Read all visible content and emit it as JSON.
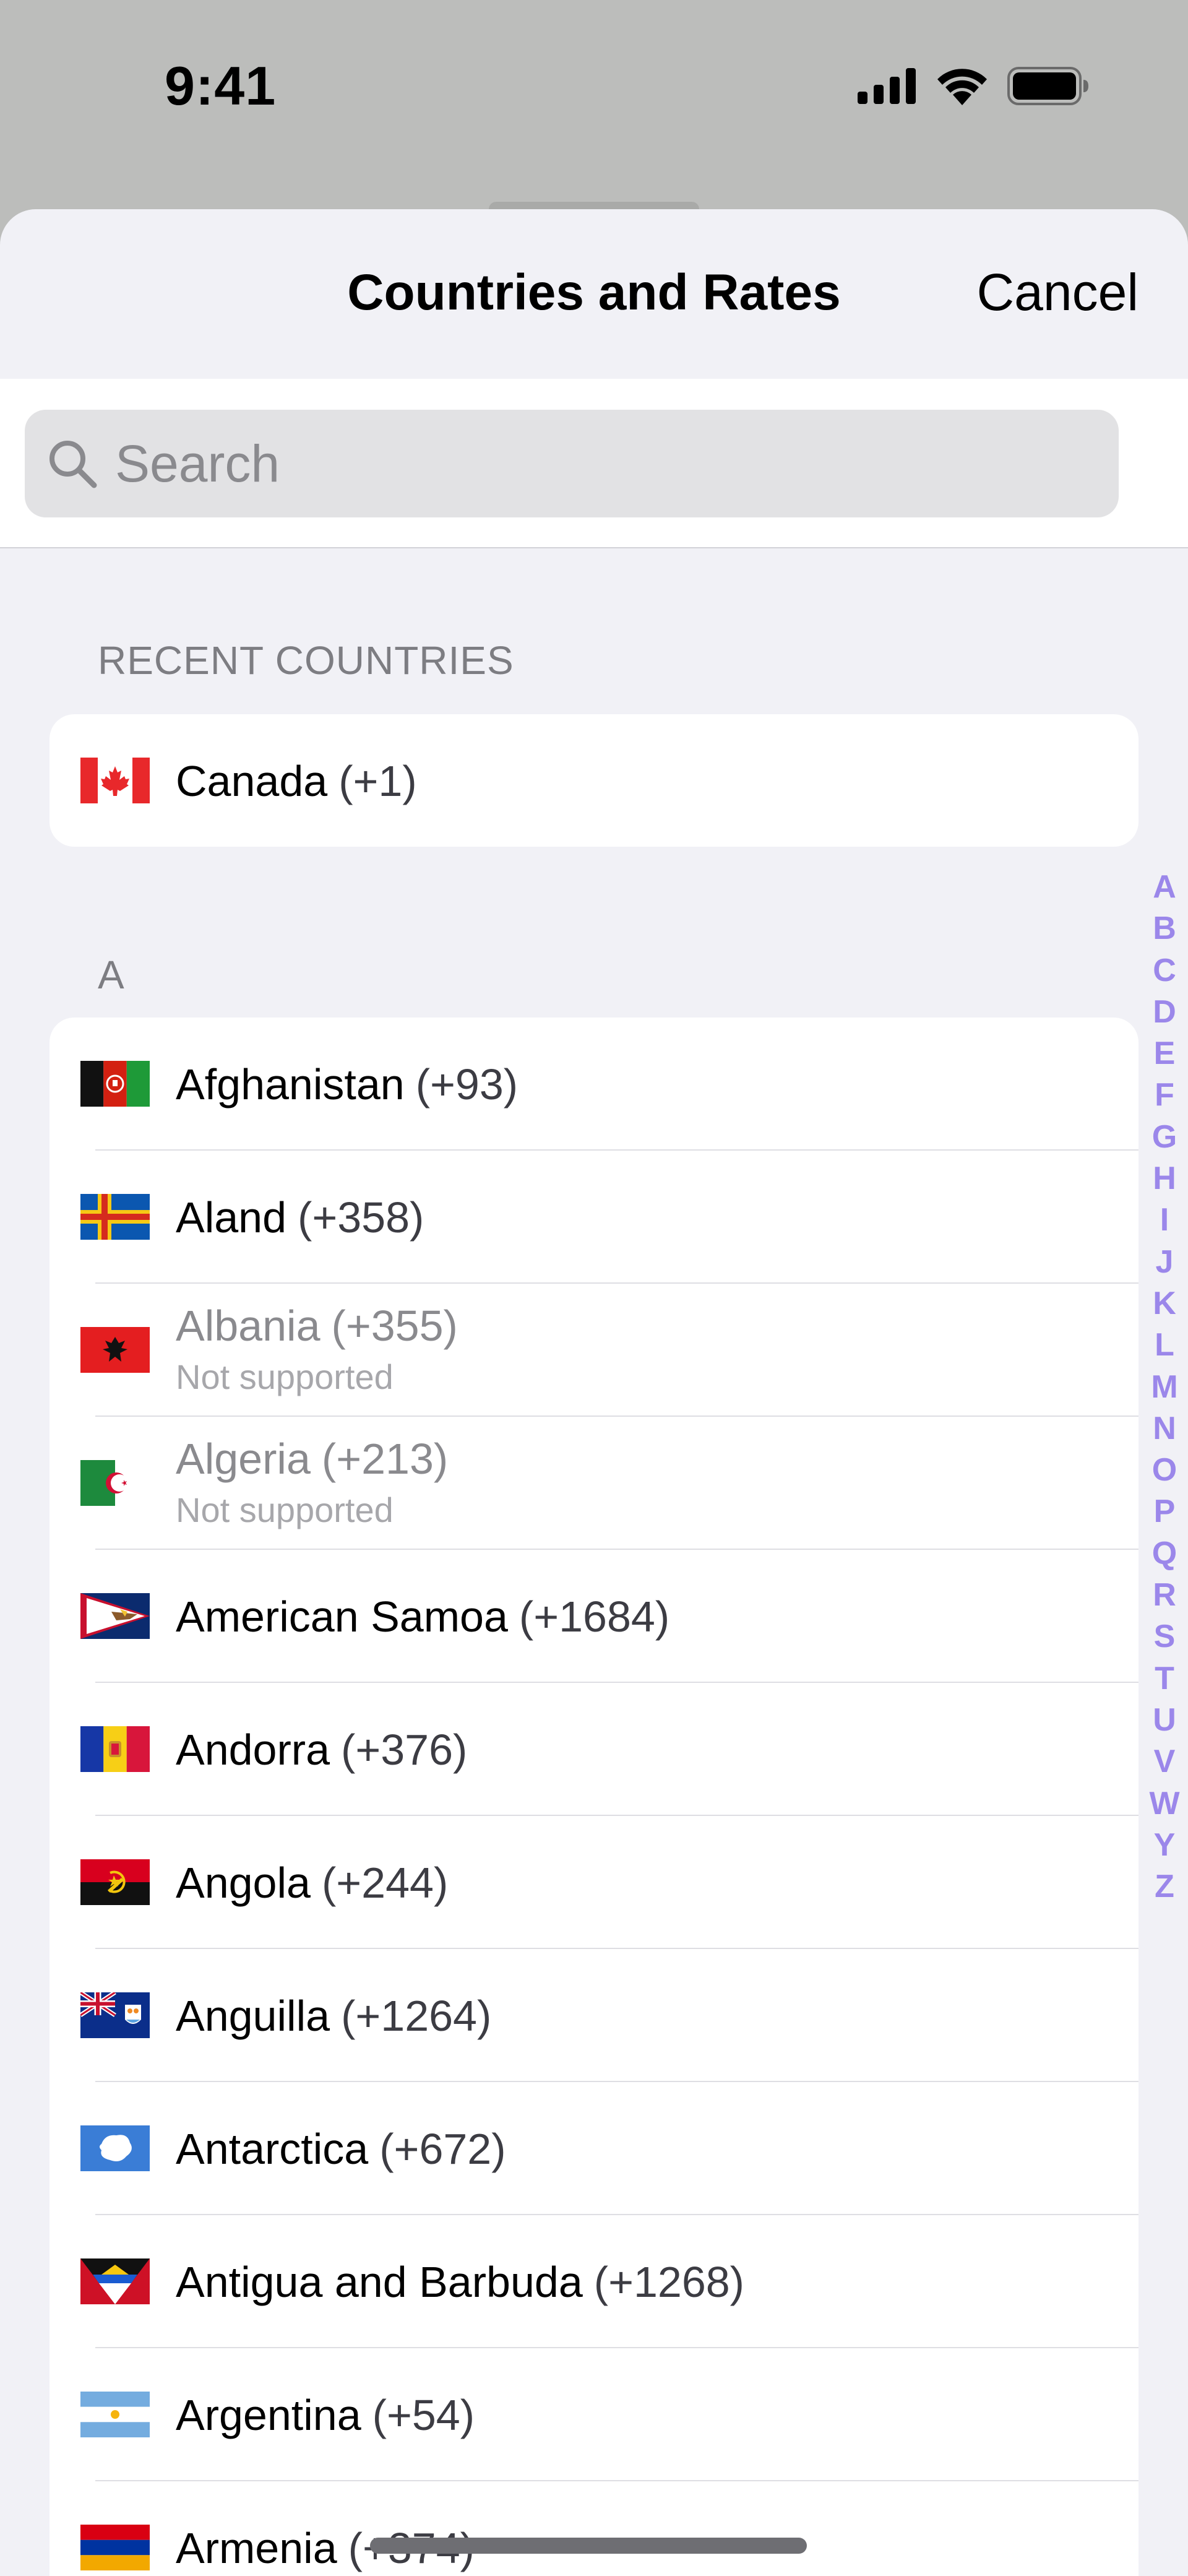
{
  "status_bar": {
    "time": "9:41",
    "icons": [
      "cellular-signal-icon",
      "wifi-icon",
      "battery-icon"
    ]
  },
  "nav": {
    "title": "Countries and Rates",
    "cancel_label": "Cancel"
  },
  "search": {
    "placeholder": "Search",
    "value": ""
  },
  "recent": {
    "header": "RECENT COUNTRIES",
    "items": [
      {
        "name": "Canada",
        "code": "(+1)",
        "flag_icon": "canada-flag-icon"
      }
    ]
  },
  "section_a": {
    "header": "A",
    "items": [
      {
        "name": "Afghanistan",
        "code": "(+93)",
        "flag_icon": "afghanistan-flag-icon"
      },
      {
        "name": "Aland",
        "code": "(+358)",
        "flag_icon": "aland-flag-icon"
      },
      {
        "name": "Albania",
        "code": "(+355)",
        "sub": "Not supported",
        "flag_icon": "albania-flag-icon"
      },
      {
        "name": "Algeria",
        "code": "(+213)",
        "sub": "Not supported",
        "flag_icon": "algeria-flag-icon"
      },
      {
        "name": "American Samoa",
        "code": "(+1684)",
        "flag_icon": "american-samoa-flag-icon"
      },
      {
        "name": "Andorra",
        "code": "(+376)",
        "flag_icon": "andorra-flag-icon"
      },
      {
        "name": "Angola",
        "code": "(+244)",
        "flag_icon": "angola-flag-icon"
      },
      {
        "name": "Anguilla",
        "code": "(+1264)",
        "flag_icon": "anguilla-flag-icon"
      },
      {
        "name": "Antarctica",
        "code": "(+672)",
        "flag_icon": "antarctica-flag-icon"
      },
      {
        "name": "Antigua and Barbuda",
        "code": "(+1268)",
        "flag_icon": "antigua-and-barbuda-flag-icon"
      },
      {
        "name": "Argentina",
        "code": "(+54)",
        "flag_icon": "argentina-flag-icon"
      },
      {
        "name": "Armenia",
        "code": "(+374)",
        "flag_icon": "armenia-flag-icon"
      }
    ]
  },
  "index_letters": [
    "A",
    "B",
    "C",
    "D",
    "E",
    "F",
    "G",
    "H",
    "I",
    "J",
    "K",
    "L",
    "M",
    "N",
    "O",
    "P",
    "Q",
    "R",
    "S",
    "T",
    "U",
    "V",
    "W",
    "Y",
    "Z"
  ],
  "colors": {
    "sheet_background": "#f1f1f6",
    "index_accent": "#9b87ea",
    "unsupported_text": "#8a8a8e"
  }
}
